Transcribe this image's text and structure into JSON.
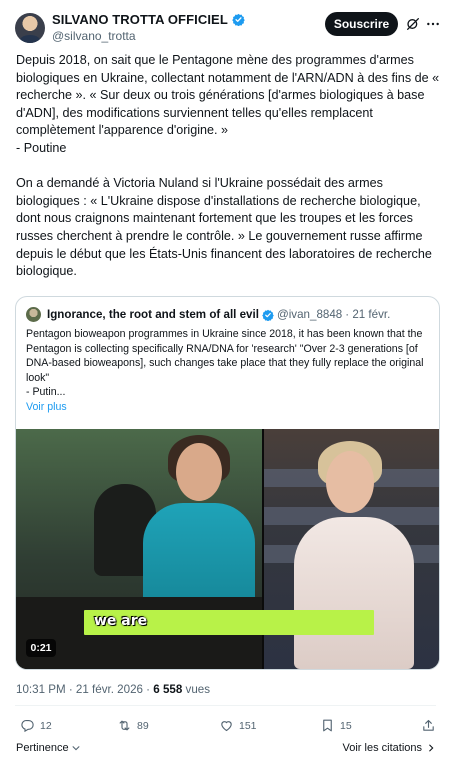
{
  "author": {
    "name": "SILVANO TROTTA OFFICIEL",
    "handle": "@silvano_trotta"
  },
  "header": {
    "subscribe_label": "Souscrire"
  },
  "tweet": {
    "text": "Depuis 2018, on sait que le Pentagone mène des programmes d'armes biologiques en Ukraine, collectant notamment de l'ARN/ADN à des fins de « recherche ». « Sur deux ou trois générations [d'armes biologiques à base d'ADN], des modifications surviennent telles qu'elles remplacent complètement l'apparence d'origine. »\n- Poutine\n\nOn a demandé à Victoria Nuland si l'Ukraine possédait des armes biologiques : « L'Ukraine dispose d'installations de recherche biologique, dont nous craignons maintenant fortement que les troupes et les forces russes cherchent à prendre le contrôle. » Le gouvernement russe affirme depuis le début que les États-Unis financent des laboratoires de recherche biologique."
  },
  "quote": {
    "name": "Ignorance, the root and stem of all evil",
    "handle": "@ivan_8848",
    "date": "· 21 févr.",
    "text": "Pentagon bioweapon programmes in Ukraine since 2018, it has been known that the Pentagon is collecting specifically RNA/DNA for 'research'  \"Over 2-3 generations [of DNA-based bioweapons], such changes take place that they fully replace the original look\"\n - Putin...",
    "show_more": "Voir plus",
    "video": {
      "caption": "we are",
      "duration": "0:21"
    }
  },
  "meta": {
    "time": "10:31 PM · 21 févr. 2026 · ",
    "views_count": "6 558",
    "views_label": " vues"
  },
  "actions": {
    "replies": "12",
    "retweets": "89",
    "likes": "151",
    "bookmarks": "15"
  },
  "bottom": {
    "relevance_label": "Pertinence",
    "quotes_label": "Voir les citations"
  },
  "colors": {
    "accent": "#1d9bf0",
    "text": "#0f1419",
    "muted": "#536471",
    "caption_bg": "#b8f248"
  }
}
